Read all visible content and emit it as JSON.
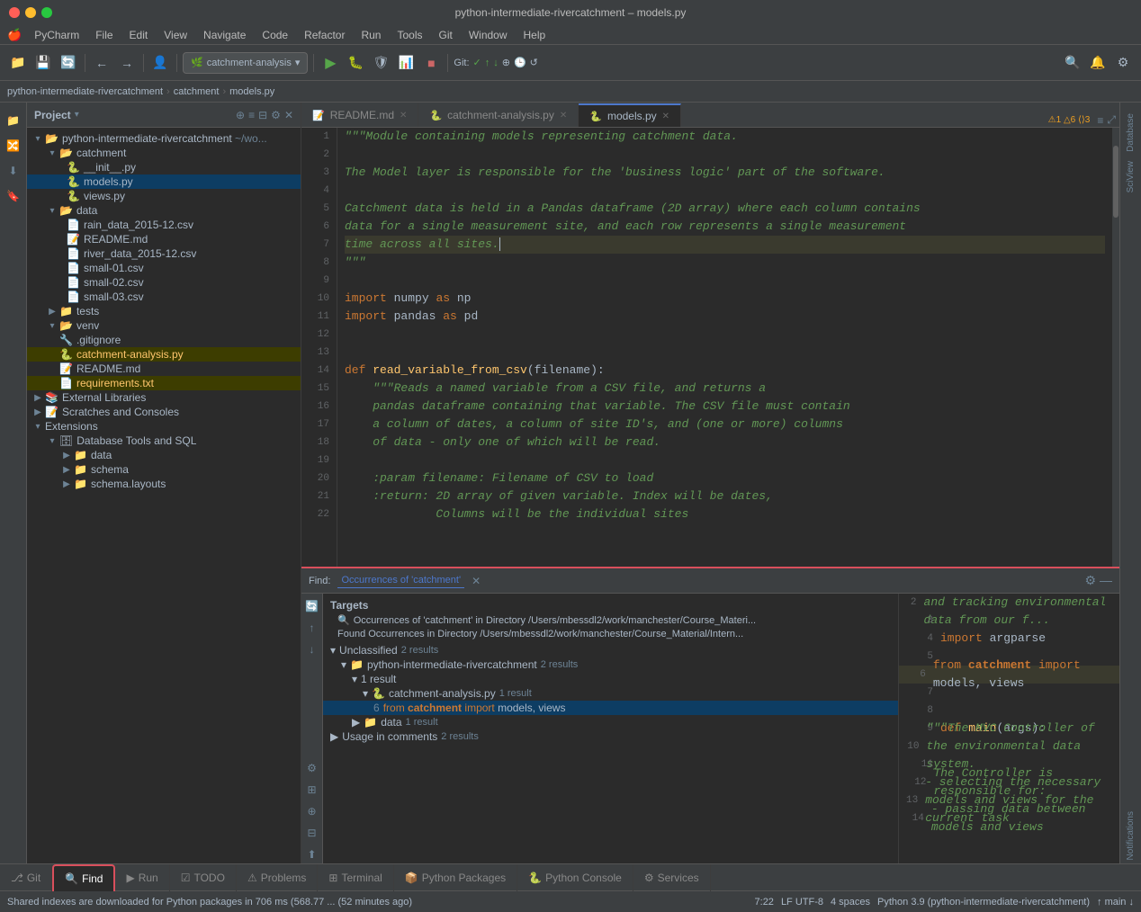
{
  "window": {
    "title": "python-intermediate-rivercatchment – models.py"
  },
  "menu": {
    "logo": "🍎",
    "items": [
      "PyCharm",
      "File",
      "Edit",
      "View",
      "Navigate",
      "Code",
      "Refactor",
      "Run",
      "Tools",
      "Git",
      "Window",
      "Help"
    ]
  },
  "toolbar": {
    "branch": "catchment-analysis",
    "git_label": "Git:",
    "git_check": "✓",
    "git_arrows": "↑↓"
  },
  "breadcrumb": {
    "items": [
      "python-intermediate-rivercatchment",
      "catchment",
      "models.py"
    ]
  },
  "tabs": {
    "items": [
      {
        "label": "README.md",
        "icon": "📄",
        "active": false,
        "closable": true
      },
      {
        "label": "catchment-analysis.py",
        "icon": "🐍",
        "active": false,
        "closable": true
      },
      {
        "label": "models.py",
        "icon": "🐍",
        "active": true,
        "closable": true
      }
    ],
    "warning": "⚠1 △6 ⟨⟩3"
  },
  "project": {
    "title": "Project",
    "root": {
      "label": "python-intermediate-rivercatchment",
      "suffix": "~/wo...",
      "children": [
        {
          "label": "catchment",
          "type": "folder",
          "expanded": true,
          "children": [
            {
              "label": "__init__.py",
              "type": "py"
            },
            {
              "label": "models.py",
              "type": "py",
              "selected": true
            },
            {
              "label": "views.py",
              "type": "py"
            }
          ]
        },
        {
          "label": "data",
          "type": "folder",
          "expanded": true,
          "children": [
            {
              "label": "rain_data_2015-12.csv",
              "type": "csv"
            },
            {
              "label": "README.md",
              "type": "md"
            },
            {
              "label": "river_data_2015-12.csv",
              "type": "csv"
            },
            {
              "label": "small-01.csv",
              "type": "csv"
            },
            {
              "label": "small-02.csv",
              "type": "csv"
            },
            {
              "label": "small-03.csv",
              "type": "csv"
            }
          ]
        },
        {
          "label": "tests",
          "type": "folder",
          "expanded": false
        },
        {
          "label": "venv",
          "type": "folder",
          "expanded": false
        },
        {
          "label": ".gitignore",
          "type": "git"
        },
        {
          "label": "catchment-analysis.py",
          "type": "py",
          "highlighted": true
        },
        {
          "label": "README.md",
          "type": "md"
        },
        {
          "label": "requirements.txt",
          "type": "txt",
          "highlighted": true
        }
      ]
    },
    "external_libraries": "External Libraries",
    "scratches": "Scratches and Consoles"
  },
  "editor": {
    "lines": [
      {
        "num": 1,
        "text": "\"\"\"Module containing models representing catchment data.",
        "type": "docstring"
      },
      {
        "num": 2,
        "text": "",
        "type": "normal"
      },
      {
        "num": 3,
        "text": "The Model layer is responsible for the 'business logic' part of the software.",
        "type": "docstring"
      },
      {
        "num": 4,
        "text": "",
        "type": "normal"
      },
      {
        "num": 5,
        "text": "Catchment data is held in a Pandas dataframe (2D array) where each column contains",
        "type": "docstring"
      },
      {
        "num": 6,
        "text": "data for a single measurement site, and each row represents a single measurement",
        "type": "docstring"
      },
      {
        "num": 7,
        "text": "time across all sites.",
        "type": "docstring",
        "highlighted": true
      },
      {
        "num": 8,
        "text": "\"\"\"",
        "type": "docstring"
      },
      {
        "num": 9,
        "text": "",
        "type": "normal"
      },
      {
        "num": 10,
        "text": "import numpy as np",
        "type": "import"
      },
      {
        "num": 11,
        "text": "import pandas as pd",
        "type": "import"
      },
      {
        "num": 12,
        "text": "",
        "type": "normal"
      },
      {
        "num": 13,
        "text": "",
        "type": "normal"
      },
      {
        "num": 14,
        "text": "def read_variable_from_csv(filename):",
        "type": "funcdef"
      },
      {
        "num": 15,
        "text": "    \"\"\"Reads a named variable from a CSV file, and returns a",
        "type": "docstring"
      },
      {
        "num": 16,
        "text": "    pandas dataframe containing that variable. The CSV file must contain",
        "type": "docstring"
      },
      {
        "num": 17,
        "text": "    a column of dates, a column of site ID's, and (one or more) columns",
        "type": "docstring"
      },
      {
        "num": 18,
        "text": "    of data - only one of which will be read.",
        "type": "docstring"
      },
      {
        "num": 19,
        "text": "",
        "type": "normal"
      },
      {
        "num": 20,
        "text": "    :param filename: Filename of CSV to load",
        "type": "docstring"
      },
      {
        "num": 21,
        "text": "    :return: 2D array of given variable. Index will be dates,",
        "type": "docstring"
      },
      {
        "num": 22,
        "text": "             Columns will be the individual sites",
        "type": "docstring"
      }
    ]
  },
  "find_panel": {
    "title": "Find:",
    "tab": "Occurrences of 'catchment'",
    "query": "catchment",
    "header_text": "Targets",
    "search_path": "Occurrences of 'catchment' in Directory /Users/mbessdl2/work/manchester/Course_Materi...",
    "found_text": "Found Occurrences in Directory /Users/mbessdl2/work/manchester/Course_Material/Intern...",
    "results": {
      "unclassified": {
        "label": "Unclassified",
        "count": "2 results",
        "children": [
          {
            "label": "python-intermediate-rivercatchment",
            "count": "2 results",
            "children": [
              {
                "label": "1 result",
                "children": [
                  {
                    "label": "catchment-analysis.py",
                    "count": "1 result",
                    "children": [
                      {
                        "line": "6",
                        "text": "from catchment import models, views",
                        "match_word": "catchment",
                        "selected": true
                      }
                    ]
                  }
                ]
              },
              {
                "label": "data",
                "count": "1 result"
              }
            ]
          }
        ]
      },
      "usage_in_comments": {
        "label": "Usage in comments",
        "count": "2 results"
      }
    },
    "preview": {
      "lines": [
        {
          "num": 2,
          "text": "\"\"\"Software for managing and tracking environmental data from our f..."
        },
        {
          "num": 3,
          "text": ""
        },
        {
          "num": 4,
          "text": "import argparse"
        },
        {
          "num": 5,
          "text": ""
        },
        {
          "num": 6,
          "text": "from catchment import models, views",
          "highlighted": true
        },
        {
          "num": 7,
          "text": ""
        },
        {
          "num": 8,
          "text": ""
        },
        {
          "num": 9,
          "text": "def main(args):"
        },
        {
          "num": 10,
          "text": "    \"\"\"The MVC Controller of the environmental data system."
        },
        {
          "num": 11,
          "text": ""
        },
        {
          "num": 12,
          "text": "    The Controller is responsible for:"
        },
        {
          "num": 13,
          "text": "    - selecting the necessary models and views for the current task"
        },
        {
          "num": 14,
          "text": "    - passing data between models and views"
        }
      ]
    }
  },
  "status_bar": {
    "message": "Shared indexes are downloaded for Python packages in 706 ms (568.77 ... (52 minutes ago)",
    "position": "7:22",
    "encoding": "LF  UTF-8",
    "indent": "4 spaces",
    "python": "Python 3.9 (python-intermediate-rivercatchment)",
    "git_branch": "↑ main ↓"
  },
  "bottom_tabs": {
    "items": [
      {
        "label": "Git",
        "icon": "⎇",
        "active": false
      },
      {
        "label": "Find",
        "icon": "🔍",
        "active": true
      },
      {
        "label": "Run",
        "icon": "▶",
        "active": false
      },
      {
        "label": "TODO",
        "icon": "☑",
        "active": false
      },
      {
        "label": "Problems",
        "icon": "⚠",
        "active": false
      },
      {
        "label": "Terminal",
        "icon": "⊞",
        "active": false
      },
      {
        "label": "Python Packages",
        "icon": "📦",
        "active": false
      },
      {
        "label": "Python Console",
        "icon": "🐍",
        "active": false
      },
      {
        "label": "Services",
        "icon": "⚙",
        "active": false
      }
    ]
  },
  "right_sidebar": {
    "items": [
      "Database",
      "SciView",
      "Notifications"
    ]
  }
}
